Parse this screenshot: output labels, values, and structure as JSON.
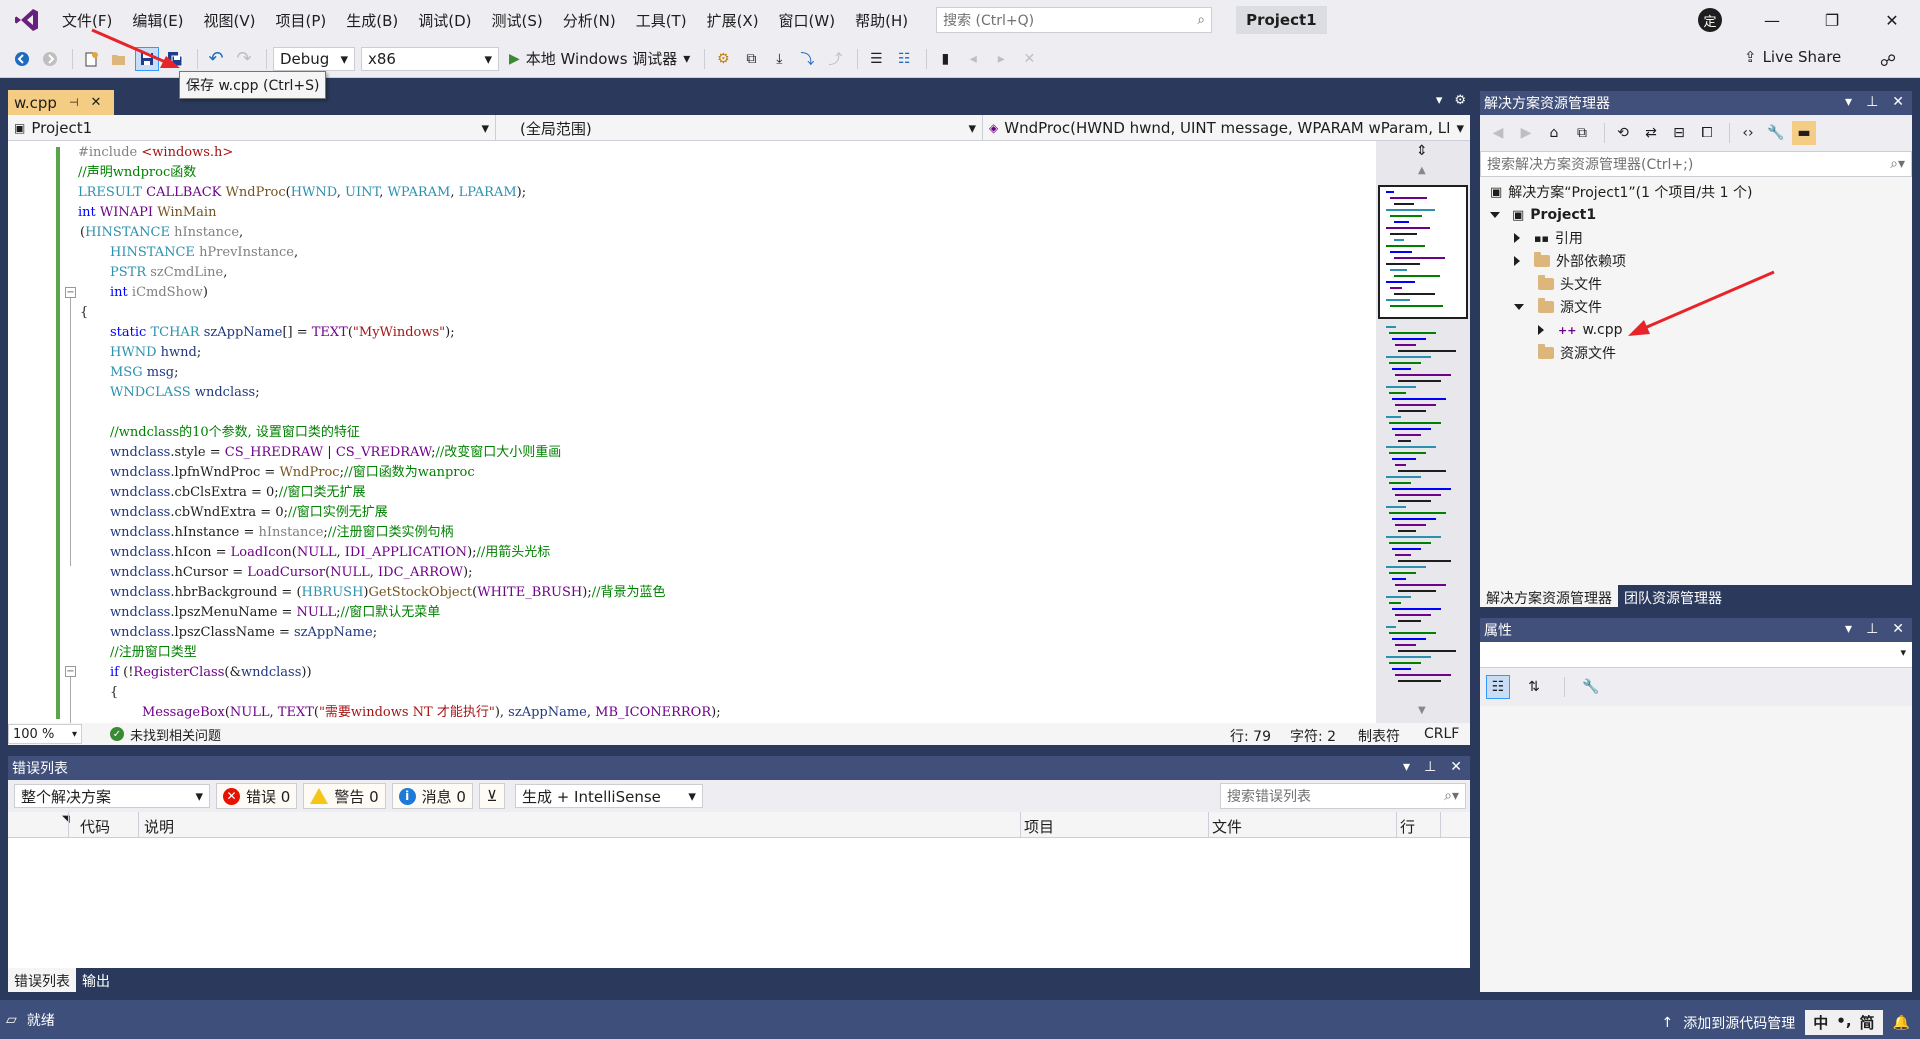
{
  "menu": {
    "items": [
      "文件(F)",
      "编辑(E)",
      "视图(V)",
      "项目(P)",
      "生成(B)",
      "调试(D)",
      "测试(S)",
      "分析(N)",
      "工具(T)",
      "扩展(X)",
      "窗口(W)",
      "帮助(H)"
    ],
    "search_placeholder": "搜索 (Ctrl+Q)",
    "project_name": "Project1",
    "user_initial": "定"
  },
  "toolbar": {
    "config": "Debug",
    "platform": "x86",
    "run_label": "本地 Windows 调试器",
    "live_share": "Live Share",
    "tooltip": "保存 w.cpp (Ctrl+S)"
  },
  "editor": {
    "tab_name": "w.cpp",
    "nav_project": "Project1",
    "nav_scope": "(全局范围)",
    "nav_member": "WndProc(HWND hwnd, UINT message, WPARAM wParam, LF",
    "zoom": "100 %",
    "issues": "未找到相关问题",
    "line": "行: 79",
    "col": "字符: 2",
    "tabs_mode": "制表符",
    "eol": "CRLF"
  },
  "error_list": {
    "title": "错误列表",
    "scope": "整个解决方案",
    "errors": "错误 0",
    "warnings": "警告 0",
    "messages": "消息 0",
    "source": "生成 + IntelliSense",
    "search_placeholder": "搜索错误列表",
    "columns": [
      "代码",
      "说明",
      "项目",
      "文件",
      "行"
    ],
    "tabs": [
      "错误列表",
      "输出"
    ]
  },
  "solution_explorer": {
    "title": "解决方案资源管理器",
    "search_placeholder": "搜索解决方案资源管理器(Ctrl+;)",
    "solution": "解决方案“Project1”(1 个项目/共 1 个)",
    "project": "Project1",
    "references": "引用",
    "external_deps": "外部依赖项",
    "headers": "头文件",
    "sources": "源文件",
    "file": "w.cpp",
    "resources": "资源文件",
    "tabs": [
      "解决方案资源管理器",
      "团队资源管理器"
    ]
  },
  "properties": {
    "title": "属性"
  },
  "statusbar": {
    "ready": "就绪",
    "add_source": "添加到源代码管理",
    "ime_1": "中",
    "ime_2": "简"
  }
}
